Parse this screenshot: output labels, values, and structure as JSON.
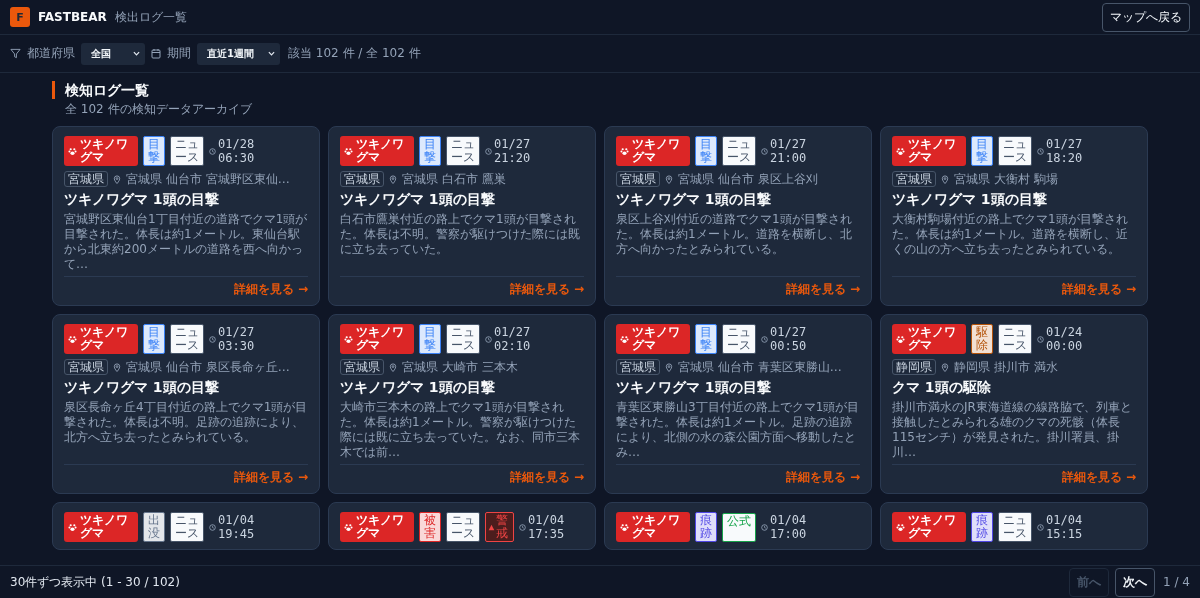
{
  "header": {
    "logo": "F",
    "brand": "FASTBEAR",
    "page_title": "検出ログ一覧",
    "back_button": "マップへ戻る"
  },
  "filters": {
    "prefecture_label": "都道府県",
    "prefecture_value": "全国",
    "period_label": "期間",
    "period_value": "直近1週間",
    "count": "該当 102 件 / 全 102 件"
  },
  "section": {
    "title": "検知ログ一覧",
    "subtitle": "全 102 件の検知データアーカイブ"
  },
  "cards": [
    {
      "species": "ツキノワグマ",
      "tags": [
        {
          "kind": "category",
          "label": "目撃",
          "color": "#3b82f6"
        },
        {
          "kind": "source",
          "label": "ニュース",
          "color": "#475569"
        }
      ],
      "date": "01/28",
      "time": "06:30",
      "prefecture": "宮城県",
      "location": "宮城県 仙台市 宮城野区東仙…",
      "title": "ツキノワグマ 1頭の目撃",
      "description": "宮城野区東仙台1丁目付近の道路でクマ1頭が目撃された。体長は約1メートル。東仙台駅から北東約200メートルの道路を西へ向かって…",
      "link": "詳細を見る →"
    },
    {
      "species": "ツキノワグマ",
      "tags": [
        {
          "kind": "category",
          "label": "目撃",
          "color": "#3b82f6"
        },
        {
          "kind": "source",
          "label": "ニュース",
          "color": "#475569"
        }
      ],
      "date": "01/27",
      "time": "21:20",
      "prefecture": "宮城県",
      "location": "宮城県 白石市 鷹巣",
      "title": "ツキノワグマ 1頭の目撃",
      "description": "白石市鷹巣付近の路上でクマ1頭が目撃された。体長は不明。警察が駆けつけた際には既に立ち去っていた。",
      "link": "詳細を見る →"
    },
    {
      "species": "ツキノワグマ",
      "tags": [
        {
          "kind": "category",
          "label": "目撃",
          "color": "#3b82f6"
        },
        {
          "kind": "source",
          "label": "ニュース",
          "color": "#475569"
        }
      ],
      "date": "01/27",
      "time": "21:00",
      "prefecture": "宮城県",
      "location": "宮城県 仙台市 泉区上谷刈",
      "title": "ツキノワグマ 1頭の目撃",
      "description": "泉区上谷刈付近の道路でクマ1頭が目撃された。体長は約1メートル。道路を横断し、北方へ向かったとみられている。",
      "link": "詳細を見る →"
    },
    {
      "species": "ツキノワグマ",
      "tags": [
        {
          "kind": "category",
          "label": "目撃",
          "color": "#3b82f6"
        },
        {
          "kind": "source",
          "label": "ニュース",
          "color": "#475569"
        }
      ],
      "date": "01/27",
      "time": "18:20",
      "prefecture": "宮城県",
      "location": "宮城県 大衡村 駒場",
      "title": "ツキノワグマ 1頭の目撃",
      "description": "大衡村駒場付近の路上でクマ1頭が目撃された。体長は約1メートル。道路を横断し、近くの山の方へ立ち去ったとみられている。",
      "link": "詳細を見る →"
    },
    {
      "species": "ツキノワグマ",
      "tags": [
        {
          "kind": "category",
          "label": "目撃",
          "color": "#3b82f6"
        },
        {
          "kind": "source",
          "label": "ニュース",
          "color": "#475569"
        }
      ],
      "date": "01/27",
      "time": "03:30",
      "prefecture": "宮城県",
      "location": "宮城県 仙台市 泉区長命ヶ丘…",
      "title": "ツキノワグマ 1頭の目撃",
      "description": "泉区長命ヶ丘4丁目付近の路上でクマ1頭が目撃された。体長は不明。足跡の追跡により、北方へ立ち去ったとみられている。",
      "link": "詳細を見る →"
    },
    {
      "species": "ツキノワグマ",
      "tags": [
        {
          "kind": "category",
          "label": "目撃",
          "color": "#3b82f6"
        },
        {
          "kind": "source",
          "label": "ニュース",
          "color": "#475569"
        }
      ],
      "date": "01/27",
      "time": "02:10",
      "prefecture": "宮城県",
      "location": "宮城県 大崎市 三本木",
      "title": "ツキノワグマ 1頭の目撃",
      "description": "大崎市三本木の路上でクマ1頭が目撃された。体長は約1メートル。警察が駆けつけた際には既に立ち去っていた。なお、同市三本木では前…",
      "link": "詳細を見る →"
    },
    {
      "species": "ツキノワグマ",
      "tags": [
        {
          "kind": "category",
          "label": "目撃",
          "color": "#3b82f6"
        },
        {
          "kind": "source",
          "label": "ニュース",
          "color": "#475569"
        }
      ],
      "date": "01/27",
      "time": "00:50",
      "prefecture": "宮城県",
      "location": "宮城県 仙台市 青葉区東勝山…",
      "title": "ツキノワグマ 1頭の目撃",
      "description": "青葉区東勝山3丁目付近の路上でクマ1頭が目撃された。体長は約1メートル。足跡の追跡により、北側の水の森公園方面へ移動したとみ…",
      "link": "詳細を見る →"
    },
    {
      "species": "ツキノワグマ",
      "tags": [
        {
          "kind": "category",
          "label": "駆除",
          "color": "#b45309"
        },
        {
          "kind": "source",
          "label": "ニュース",
          "color": "#475569"
        }
      ],
      "date": "01/24",
      "time": "00:00",
      "prefecture": "静岡県",
      "location": "静岡県 掛川市 満水",
      "title": "クマ 1頭の駆除",
      "description": "掛川市満水のJR東海道線の線路脇で、列車と接触したとみられる雄のクマの死骸（体長115センチ）が発見された。掛川署員、掛川…",
      "link": "詳細を見る →"
    },
    {
      "species": "ツキノワグマ",
      "tags": [
        {
          "kind": "category",
          "label": "出没",
          "color": "#64748b"
        },
        {
          "kind": "source",
          "label": "ニュース",
          "color": "#475569"
        }
      ],
      "date": "01/04",
      "time": "19:45"
    },
    {
      "species": "ツキノワグマ",
      "tags": [
        {
          "kind": "category",
          "label": "被害",
          "color": "#dc2626"
        },
        {
          "kind": "source",
          "label": "ニュース",
          "color": "#475569"
        },
        {
          "kind": "alert",
          "label": "警戒",
          "color": "#ef4444"
        }
      ],
      "date": "01/04",
      "time": "17:35"
    },
    {
      "species": "ツキノワグマ",
      "tags": [
        {
          "kind": "category",
          "label": "痕跡",
          "color": "#4f46e5"
        },
        {
          "kind": "source",
          "label": "公式",
          "color": "#16a34a"
        }
      ],
      "date": "01/04",
      "time": "17:00"
    },
    {
      "species": "ツキノワグマ",
      "tags": [
        {
          "kind": "category",
          "label": "痕跡",
          "color": "#4f46e5"
        },
        {
          "kind": "source",
          "label": "ニュース",
          "color": "#475569"
        }
      ],
      "date": "01/04",
      "time": "15:15"
    }
  ],
  "footer": {
    "status": "30件ずつ表示中 (1 - 30 / 102)",
    "prev": {
      "label": "前へ",
      "disabled": true
    },
    "next": {
      "label": "次へ",
      "disabled": false
    },
    "page": "1 / 4"
  }
}
